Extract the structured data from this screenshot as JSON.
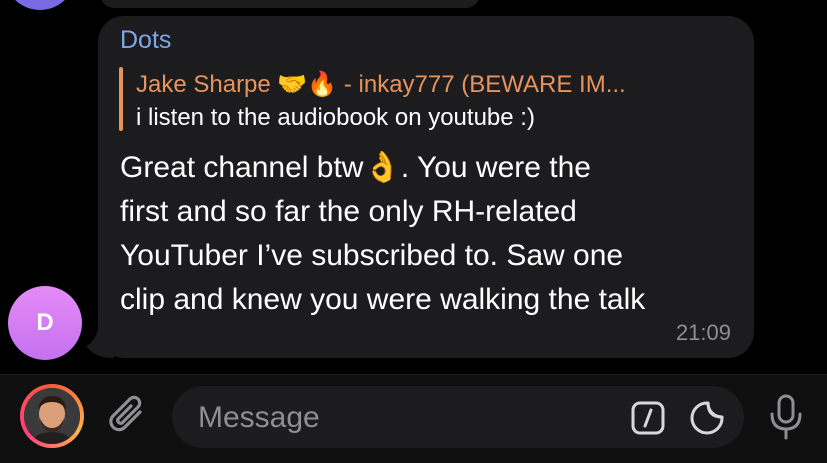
{
  "message": {
    "sender_name": "Dots",
    "sender_initial": "D",
    "reply": {
      "author": "Jake Sharpe 🤝🔥 - inkay777 (BEWARE IM...",
      "text": "i listen to the audiobook on youtube :)"
    },
    "text_lines": [
      "Great channel btw👌. You were the",
      "first and so far the only RH-related",
      "YouTuber I’ve subscribed to. Saw one",
      "clip and knew you were walking the talk"
    ],
    "time": "21:09"
  },
  "composer": {
    "placeholder": "Message"
  },
  "icons": {
    "attach": "paperclip-icon",
    "commands": "slash-command-icon",
    "sticker": "sticker-icon",
    "voice": "microphone-icon",
    "profile": "profile-avatar"
  },
  "colors": {
    "sender_name": "#7fa6e5",
    "reply_accent": "#e6935d",
    "bubble": "#1c1c1e",
    "avatar": "#c471f0"
  }
}
